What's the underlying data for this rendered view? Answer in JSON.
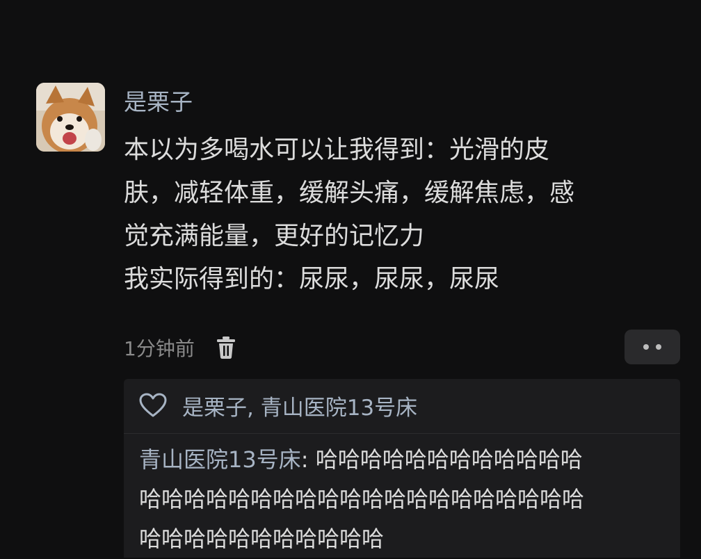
{
  "post": {
    "username": "是栗子",
    "content_lines": [
      "本以为多喝水可以让我得到：光滑的皮",
      "肤，减轻体重，缓解头痛，缓解焦虑，感",
      "觉充满能量，更好的记忆力",
      "我实际得到的：尿尿，尿尿，尿尿"
    ],
    "timestamp": "1分钟前",
    "delete_icon": "trash-icon",
    "more_icon": "more-dots-icon"
  },
  "interactions": {
    "like_icon": "heart-outline-icon",
    "likers": "是栗子, 青山医院13号床"
  },
  "reply": {
    "author": "青山医院13号床",
    "separator": ": ",
    "lines": [
      "哈哈哈哈哈哈哈哈哈哈哈哈",
      "哈哈哈哈哈哈哈哈哈哈哈哈哈哈哈哈哈哈哈哈",
      "哈哈哈哈哈哈哈哈哈哈哈"
    ]
  },
  "colors": {
    "background": "#0f0f10",
    "name_blue": "#a7b4c4",
    "text": "#dcdcdc",
    "muted": "#8a8a8a",
    "reply_bg": "#1c1c1e"
  }
}
